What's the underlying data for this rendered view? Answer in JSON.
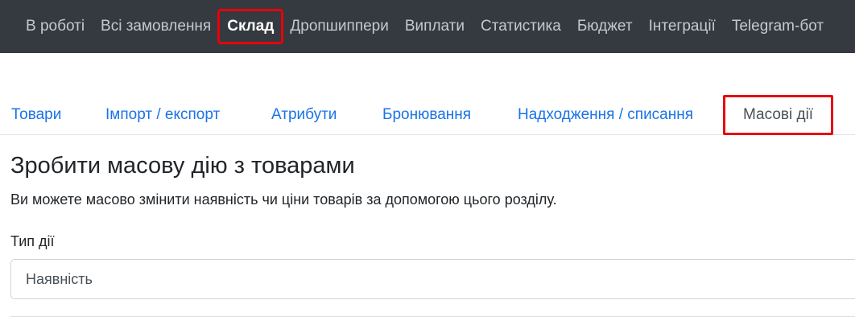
{
  "topnav": {
    "items": [
      {
        "label": "В роботі"
      },
      {
        "label": "Всі замовлення"
      },
      {
        "label": "Склад"
      },
      {
        "label": "Дропшиппери"
      },
      {
        "label": "Виплати"
      },
      {
        "label": "Статистика"
      },
      {
        "label": "Бюджет"
      },
      {
        "label": "Інтеграції"
      },
      {
        "label": "Telegram-бот"
      }
    ],
    "active_index": 2
  },
  "tabs": {
    "items": [
      {
        "label": "Товари"
      },
      {
        "label": "Імпорт / експорт"
      },
      {
        "label": "Атрибути"
      },
      {
        "label": "Бронювання"
      },
      {
        "label": "Надходження / списання"
      },
      {
        "label": "Масові дії"
      }
    ],
    "active_index": 5
  },
  "main": {
    "title": "Зробити масову дію з товарами",
    "description": "Ви можете масово змінити наявність чи ціни товарів за допомогою цього розділу.",
    "action_type_label": "Тип дії",
    "action_type_value": "Наявність"
  },
  "colors": {
    "topnav_bg": "#343a40",
    "link": "#1a73e8",
    "highlight": "#e8000b"
  }
}
